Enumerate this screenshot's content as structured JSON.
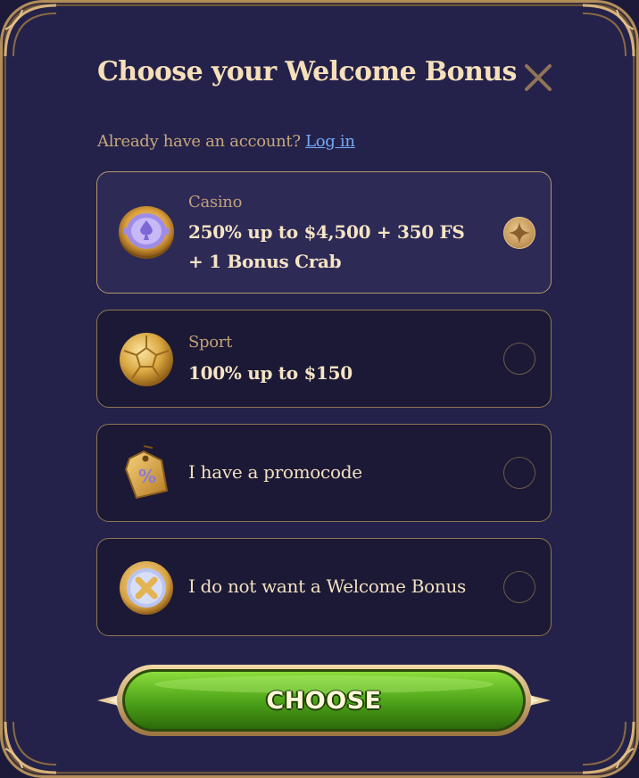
{
  "modal": {
    "title": "Choose your Welcome Bonus",
    "account_prompt": "Already have an account?",
    "login_link": "Log in",
    "close_icon": "close-icon"
  },
  "options": [
    {
      "category": "Casino",
      "title": "250% up to $4,500 + 350 FS + 1 Bonus Crab",
      "icon": "casino-chip-icon",
      "selected": true
    },
    {
      "category": "Sport",
      "title": "100% up to $150",
      "icon": "soccer-ball-icon",
      "selected": false
    },
    {
      "label": "I have a promocode",
      "icon": "promo-tag-icon",
      "selected": false
    },
    {
      "label": "I do not want a Welcome Bonus",
      "icon": "no-bonus-coin-icon",
      "selected": false
    }
  ],
  "choose_button": {
    "label": "CHOOSE"
  },
  "colors": {
    "background": "#24224a",
    "gold": "#b38d5a",
    "title": "#f6dfb9",
    "link": "#76a8f5",
    "button_green": "#4fa61a"
  }
}
